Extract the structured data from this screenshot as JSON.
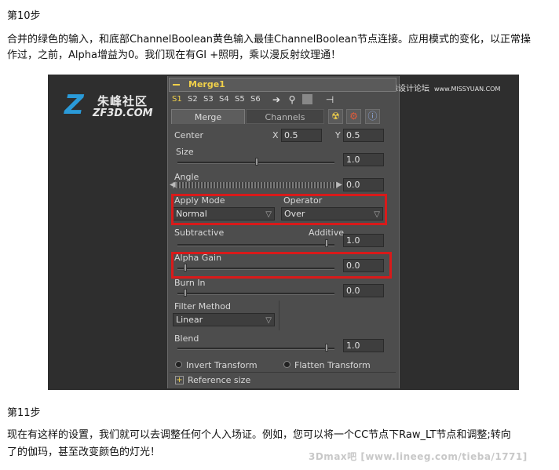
{
  "article": {
    "step10": "第10步",
    "para1_line1": "合并的绿色的输入，和底部ChannelBoolean黄色输入最佳ChannelBoolean节点连接。应用模式的变化，以正常操",
    "para1_line2": "作过，之前，Alpha增益为0。我们现在有GI +照明，乘以漫反射纹理通！",
    "step11": "第11步",
    "para2_line1": "现在有这样的设置，我们就可以去调整任何个人入场证。例如，您可以将一个CC节点下Raw_LT节点和调整;转向",
    "para2_line2": "了的伽玛，甚至改变颜色的灯光！"
  },
  "watermarks": {
    "logo_cn": "朱峰社区",
    "logo_en": "ZF3D.COM",
    "top_right": "思缘设计论坛",
    "top_right_site": "www.MISSYUAN.COM",
    "bottom": "3Dmax吧 [www.lineeg.com/tieba/1771]"
  },
  "panel": {
    "title": "Merge1",
    "tabs": [
      "S1",
      "S2",
      "S3",
      "S4",
      "S5",
      "S6"
    ],
    "main_tabs": {
      "merge": "Merge",
      "channels": "Channels"
    },
    "center": {
      "label": "Center",
      "x_label": "X",
      "x": "0.5",
      "y_label": "Y",
      "y": "0.5"
    },
    "size": {
      "label": "Size",
      "value": "1.0"
    },
    "angle": {
      "label": "Angle",
      "value": "0.0"
    },
    "apply_mode": {
      "label": "Apply Mode",
      "value": "Normal"
    },
    "operator": {
      "label": "Operator",
      "value": "Over"
    },
    "subtractive_label": "Subtractive",
    "additive_label": "Additive",
    "sub_add_value": "1.0",
    "alpha_gain": {
      "label": "Alpha Gain",
      "value": "0.0"
    },
    "burn_in": {
      "label": "Burn In",
      "value": "0.0"
    },
    "filter_method": {
      "label": "Filter Method",
      "value": "Linear"
    },
    "blend": {
      "label": "Blend",
      "value": "1.0"
    },
    "invert_transform": "Invert Transform",
    "flatten_transform": "Flatten Transform",
    "reference_size": "Reference size"
  },
  "colors": {
    "highlight": "#d91a1a",
    "accent": "#f0d04a"
  }
}
